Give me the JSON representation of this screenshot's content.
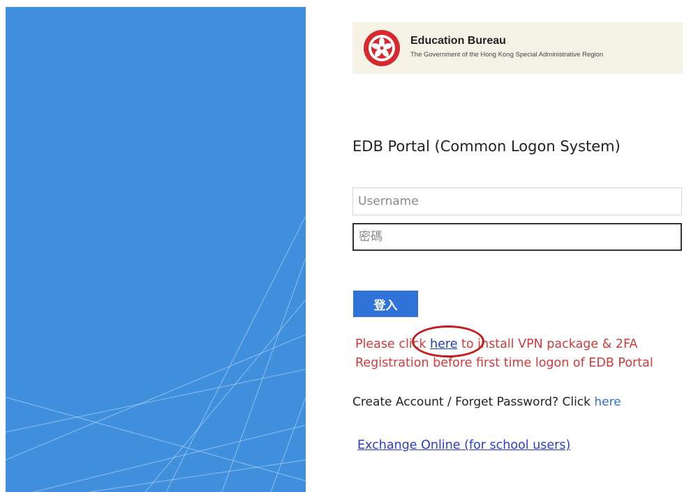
{
  "banner": {
    "title": "Education Bureau",
    "subtitle": "The Government of the Hong Kong Special Administrative Region",
    "emblem_icon": "hksar-bauhinia-emblem-icon"
  },
  "portal": {
    "title": "EDB Portal (Common Logon System)"
  },
  "form": {
    "username_placeholder": "Username",
    "username_value": "",
    "password_placeholder": "密碼",
    "password_value": "",
    "login_label": "登入"
  },
  "vpn_notice": {
    "text_before": "Please click ",
    "link_label": "here",
    "text_after": " to install VPN package & 2FA Registration before first time logon of EDB Portal"
  },
  "account": {
    "text": "Create Account / Forget Password? Click ",
    "link_label": "here"
  },
  "exchange": {
    "link_label": "Exchange Online (for school users)"
  },
  "colors": {
    "hero_blue": "#3f8fdd",
    "login_button": "#2f73d8",
    "notice_red": "#d23b3b",
    "link_blue": "#2f6fd8",
    "banner_bg": "#f4f3e6"
  }
}
